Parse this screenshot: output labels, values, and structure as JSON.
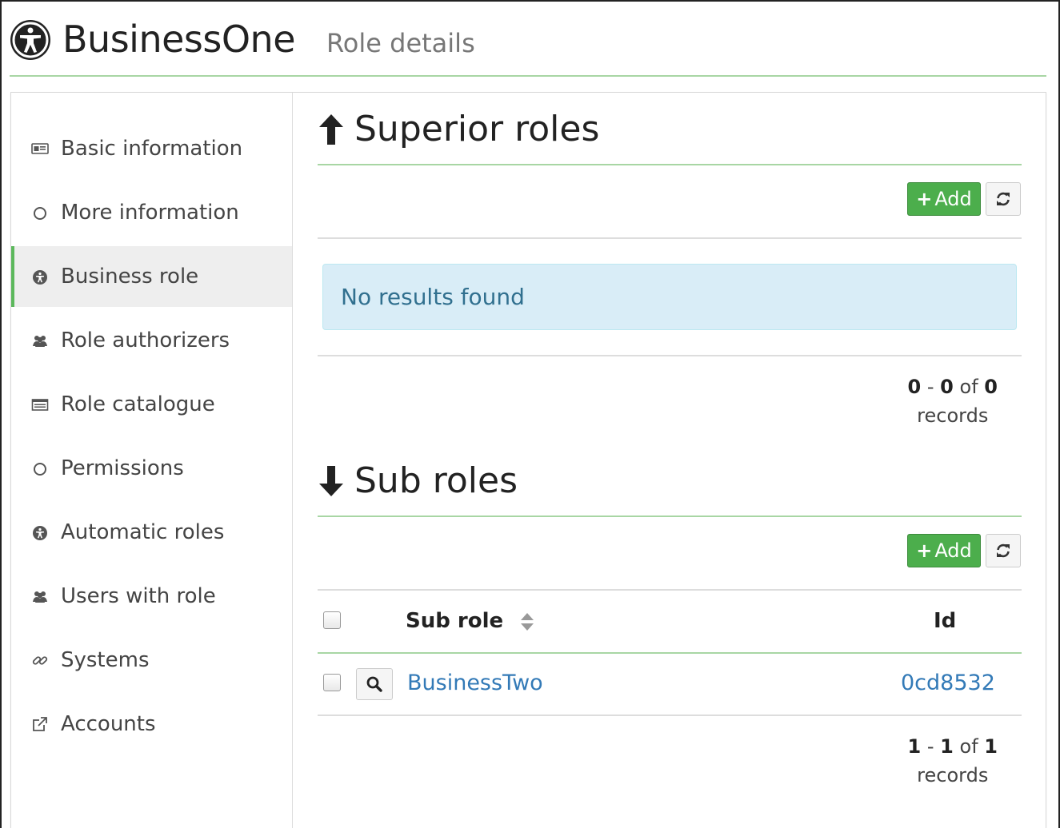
{
  "header": {
    "app_name": "BusinessOne",
    "page_subtitle": "Role details"
  },
  "sidebar": {
    "items": [
      {
        "label": "Basic information",
        "icon": "id-card-icon"
      },
      {
        "label": "More information",
        "icon": "circle-icon"
      },
      {
        "label": "Business role",
        "icon": "accessibility-icon",
        "active": true
      },
      {
        "label": "Role authorizers",
        "icon": "users-icon"
      },
      {
        "label": "Role catalogue",
        "icon": "list-icon"
      },
      {
        "label": "Permissions",
        "icon": "circle-icon"
      },
      {
        "label": "Automatic roles",
        "icon": "accessibility-icon"
      },
      {
        "label": "Users with role",
        "icon": "users-icon"
      },
      {
        "label": "Systems",
        "icon": "link-icon"
      },
      {
        "label": "Accounts",
        "icon": "external-link-icon"
      }
    ]
  },
  "superior": {
    "title": "Superior roles",
    "add_label": "Add",
    "empty_message": "No results found",
    "pager": {
      "from": "0",
      "to": "0",
      "total": "0",
      "sep": "-",
      "of": "of",
      "records": "records"
    }
  },
  "sub": {
    "title": "Sub roles",
    "add_label": "Add",
    "columns": {
      "name": "Sub role",
      "id": "Id"
    },
    "rows": [
      {
        "name": "BusinessTwo",
        "id": "0cd8532"
      }
    ],
    "pager": {
      "from": "1",
      "to": "1",
      "total": "1",
      "sep": "-",
      "of": "of",
      "records": "records"
    }
  },
  "colors": {
    "accent_green": "#5cb85c",
    "link_blue": "#337ab7",
    "info_bg": "#d9edf7"
  }
}
